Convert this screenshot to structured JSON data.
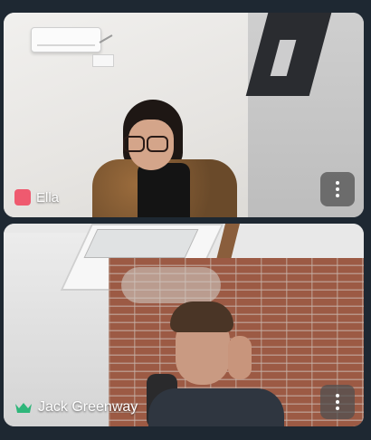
{
  "tiles": [
    {
      "participant_name": "Ella",
      "status_icon": "muted-mic-icon",
      "status_color": "#ef5a6f",
      "menu_icon": "more-vertical-icon"
    },
    {
      "participant_name": "Jack Greenway",
      "status_icon": "crown-icon",
      "status_color": "#2fb67a",
      "menu_icon": "more-vertical-icon"
    }
  ],
  "colors": {
    "background": "#1e2832",
    "label_text": "#ffffff",
    "menu_button_bg": "#505050"
  }
}
